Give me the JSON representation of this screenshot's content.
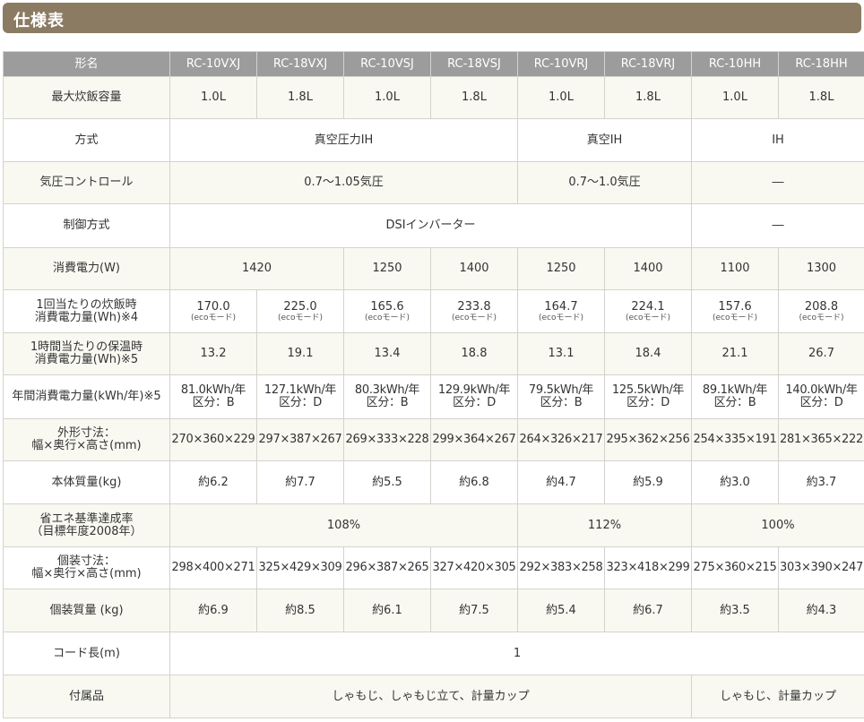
{
  "title": "仕様表",
  "header": {
    "label": "形名",
    "models": [
      "RC-10VXJ",
      "RC-18VXJ",
      "RC-10VSJ",
      "RC-18VSJ",
      "RC-10VRJ",
      "RC-18VRJ",
      "RC-10HH",
      "RC-18HH"
    ]
  },
  "rows": {
    "capacity": {
      "label": "最大炊飯容量",
      "values": [
        "1.0L",
        "1.8L",
        "1.0L",
        "1.8L",
        "1.0L",
        "1.8L",
        "1.0L",
        "1.8L"
      ]
    },
    "method": {
      "label": "方式",
      "values": [
        "真空圧力IH",
        "真空IH",
        "IH"
      ]
    },
    "pressure": {
      "label": "気圧コントロール",
      "values": [
        "0.7〜1.05気圧",
        "0.7〜1.0気圧",
        "―"
      ]
    },
    "control": {
      "label": "制御方式",
      "values": [
        "DSIインバーター",
        "―"
      ]
    },
    "power": {
      "label": "消費電力(W)",
      "values": [
        "1420",
        "1250",
        "1400",
        "1250",
        "1400",
        "1100",
        "1300"
      ]
    },
    "cook_energy": {
      "label1": "1回当たりの炊飯時",
      "label2": "消費電力量(Wh)※4",
      "values": [
        "170.0",
        "225.0",
        "165.6",
        "233.8",
        "164.7",
        "224.1",
        "157.6",
        "208.8"
      ],
      "note": "(ecoモード)"
    },
    "keep_warm": {
      "label1": "1時間当たりの保温時",
      "label2": "消費電力量(Wh)※5",
      "values": [
        "13.2",
        "19.1",
        "13.4",
        "18.8",
        "13.1",
        "18.4",
        "21.1",
        "26.7"
      ]
    },
    "annual": {
      "label": "年間消費電力量(kWh/年)※5",
      "values": [
        "81.0kWh/年",
        "127.1kWh/年",
        "80.3kWh/年",
        "129.9kWh/年",
        "79.5kWh/年",
        "125.5kWh/年",
        "89.1kWh/年",
        "140.0kWh/年"
      ],
      "classes": [
        "区分：B",
        "区分：D",
        "区分：B",
        "区分：D",
        "区分：B",
        "区分：D",
        "区分：B",
        "区分：D"
      ]
    },
    "outer_size": {
      "label1": "外形寸法：",
      "label2": "幅×奥行×高さ(mm)",
      "values": [
        "270×360×229",
        "297×387×267",
        "269×333×228",
        "299×364×267",
        "264×326×217",
        "295×362×256",
        "254×335×191",
        "281×365×222"
      ]
    },
    "weight": {
      "label": "本体質量(kg)",
      "values": [
        "約6.2",
        "約7.7",
        "約5.5",
        "約6.8",
        "約4.7",
        "約5.9",
        "約3.0",
        "約3.7"
      ]
    },
    "efficiency": {
      "label1": "省エネ基準達成率",
      "label2": "（目標年度2008年）",
      "values": [
        "108%",
        "112%",
        "100%"
      ]
    },
    "package_size": {
      "label1": "個装寸法：",
      "label2": "幅×奥行×高さ(mm)",
      "values": [
        "298×400×271",
        "325×429×309",
        "296×387×265",
        "327×420×305",
        "292×383×258",
        "323×418×299",
        "275×360×215",
        "303×390×247"
      ]
    },
    "package_weight": {
      "label": "個装質量 (kg)",
      "values": [
        "約6.9",
        "約8.5",
        "約6.1",
        "約7.5",
        "約5.4",
        "約6.7",
        "約3.5",
        "約4.3"
      ]
    },
    "cord": {
      "label": "コード長(m)",
      "values": [
        "1"
      ]
    },
    "accessories": {
      "label": "付属品",
      "values": [
        "しゃもじ、しゃもじ立て、計量カップ",
        "しゃもじ、計量カップ"
      ]
    }
  }
}
